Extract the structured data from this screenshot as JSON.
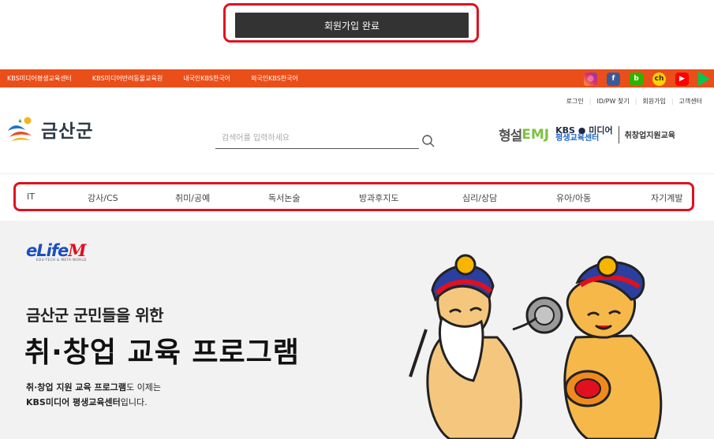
{
  "complete_button": {
    "label": "회원가입 완료"
  },
  "topbar": {
    "links": [
      "KBS미디어평생교육센터",
      "KBS미디어반려동물교육원",
      "내국인KBS한국어",
      "외국인KBS한국어"
    ],
    "sns_icons": [
      "instagram-icon",
      "facebook-icon",
      "blog-icon",
      "kakao-channel-icon",
      "youtube-icon",
      "play-store-icon"
    ],
    "color": "#ea4f1a"
  },
  "utility": {
    "links": [
      "로그인",
      "ID/PW 찾기",
      "회원가입",
      "고객센터"
    ]
  },
  "header": {
    "logo_text": "금산군",
    "search_placeholder": "검색어를 입력하세요",
    "partner": {
      "hyungseol": "형설",
      "emj": "EMJ",
      "kbs_line1": "KBS ● 미디어",
      "kbs_line2": "평생교육센터",
      "center_name": "취창업지원교육"
    }
  },
  "categories": [
    "IT",
    "강사/CS",
    "취미/공예",
    "독서논술",
    "방과후지도",
    "심리/상담",
    "유아/아동",
    "자기계발"
  ],
  "banner": {
    "brand_main": "eLife",
    "brand_m": "M",
    "brand_sub": "EDU-TECH & META-WORLD",
    "heading_small": "금산군 군민들을 위한",
    "heading_large": "취·창업 교육 프로그램",
    "desc_line1_bold": "취·창업 지원 교육 프로그램",
    "desc_line1_rest": "도 이제는",
    "desc_line2_bold": "KBS미디어 평생교육센터",
    "desc_line2_rest": "입니다."
  }
}
